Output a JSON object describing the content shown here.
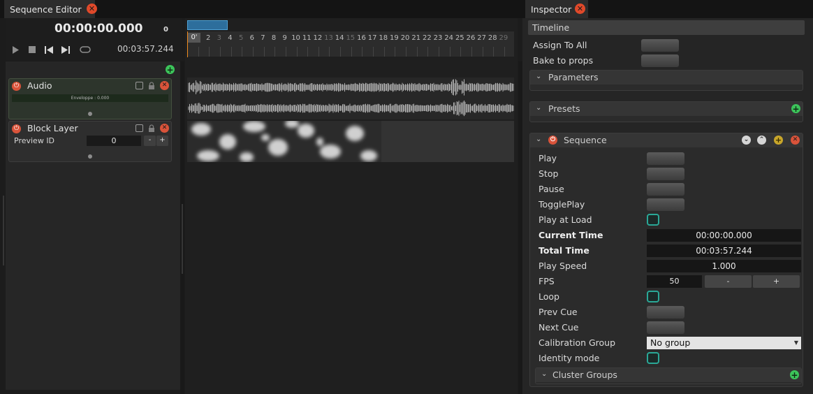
{
  "sequence_editor": {
    "tab_title": "Sequence Editor",
    "current_time": "00:00:00.000",
    "frame": "0",
    "total_time": "00:03:57.244",
    "layers": [
      {
        "name": "Audio",
        "envelope_text": "Enveloppe : 0.000"
      },
      {
        "name": "Block Layer",
        "preview_label": "Preview ID",
        "preview_value": "0",
        "minus": "-",
        "plus": "+"
      }
    ],
    "ruler": {
      "zero": "0'",
      "labels": [
        "2",
        "3",
        "4",
        "5",
        "6",
        "7",
        "8",
        "9",
        "10",
        "11",
        "12",
        "13",
        "14",
        "15",
        "16",
        "17",
        "18",
        "19",
        "20",
        "21",
        "22",
        "23",
        "24",
        "25",
        "26",
        "27",
        "28",
        "29"
      ]
    }
  },
  "inspector": {
    "tab_title": "Inspector",
    "timeline_header": "Timeline",
    "assign_to_all": "Assign To All",
    "bake_to_props": "Bake to props",
    "parameters_title": "Parameters",
    "presets_title": "Presets",
    "sequence": {
      "title": "Sequence",
      "play": "Play",
      "stop": "Stop",
      "pause": "Pause",
      "toggle_play": "TogglePlay",
      "play_at_load": "Play at Load",
      "current_time_label": "Current Time",
      "current_time_value": "00:00:00.000",
      "total_time_label": "Total Time",
      "total_time_value": "00:03:57.244",
      "play_speed_label": "Play Speed",
      "play_speed_value": "1.000",
      "fps_label": "FPS",
      "fps_value": "50",
      "fps_minus": "-",
      "fps_plus": "+",
      "loop": "Loop",
      "prev_cue": "Prev Cue",
      "next_cue": "Next Cue",
      "calibration_group_label": "Calibration Group",
      "calibration_group_value": "No group",
      "identity_mode": "Identity mode",
      "cluster_groups": "Cluster Groups"
    }
  },
  "colors": {
    "accent_teal": "#2aa897",
    "close_red": "#e0492a",
    "add_green": "#3cc45a",
    "playhead_orange": "#f08a1e",
    "range_blue": "#2d6e9c"
  }
}
